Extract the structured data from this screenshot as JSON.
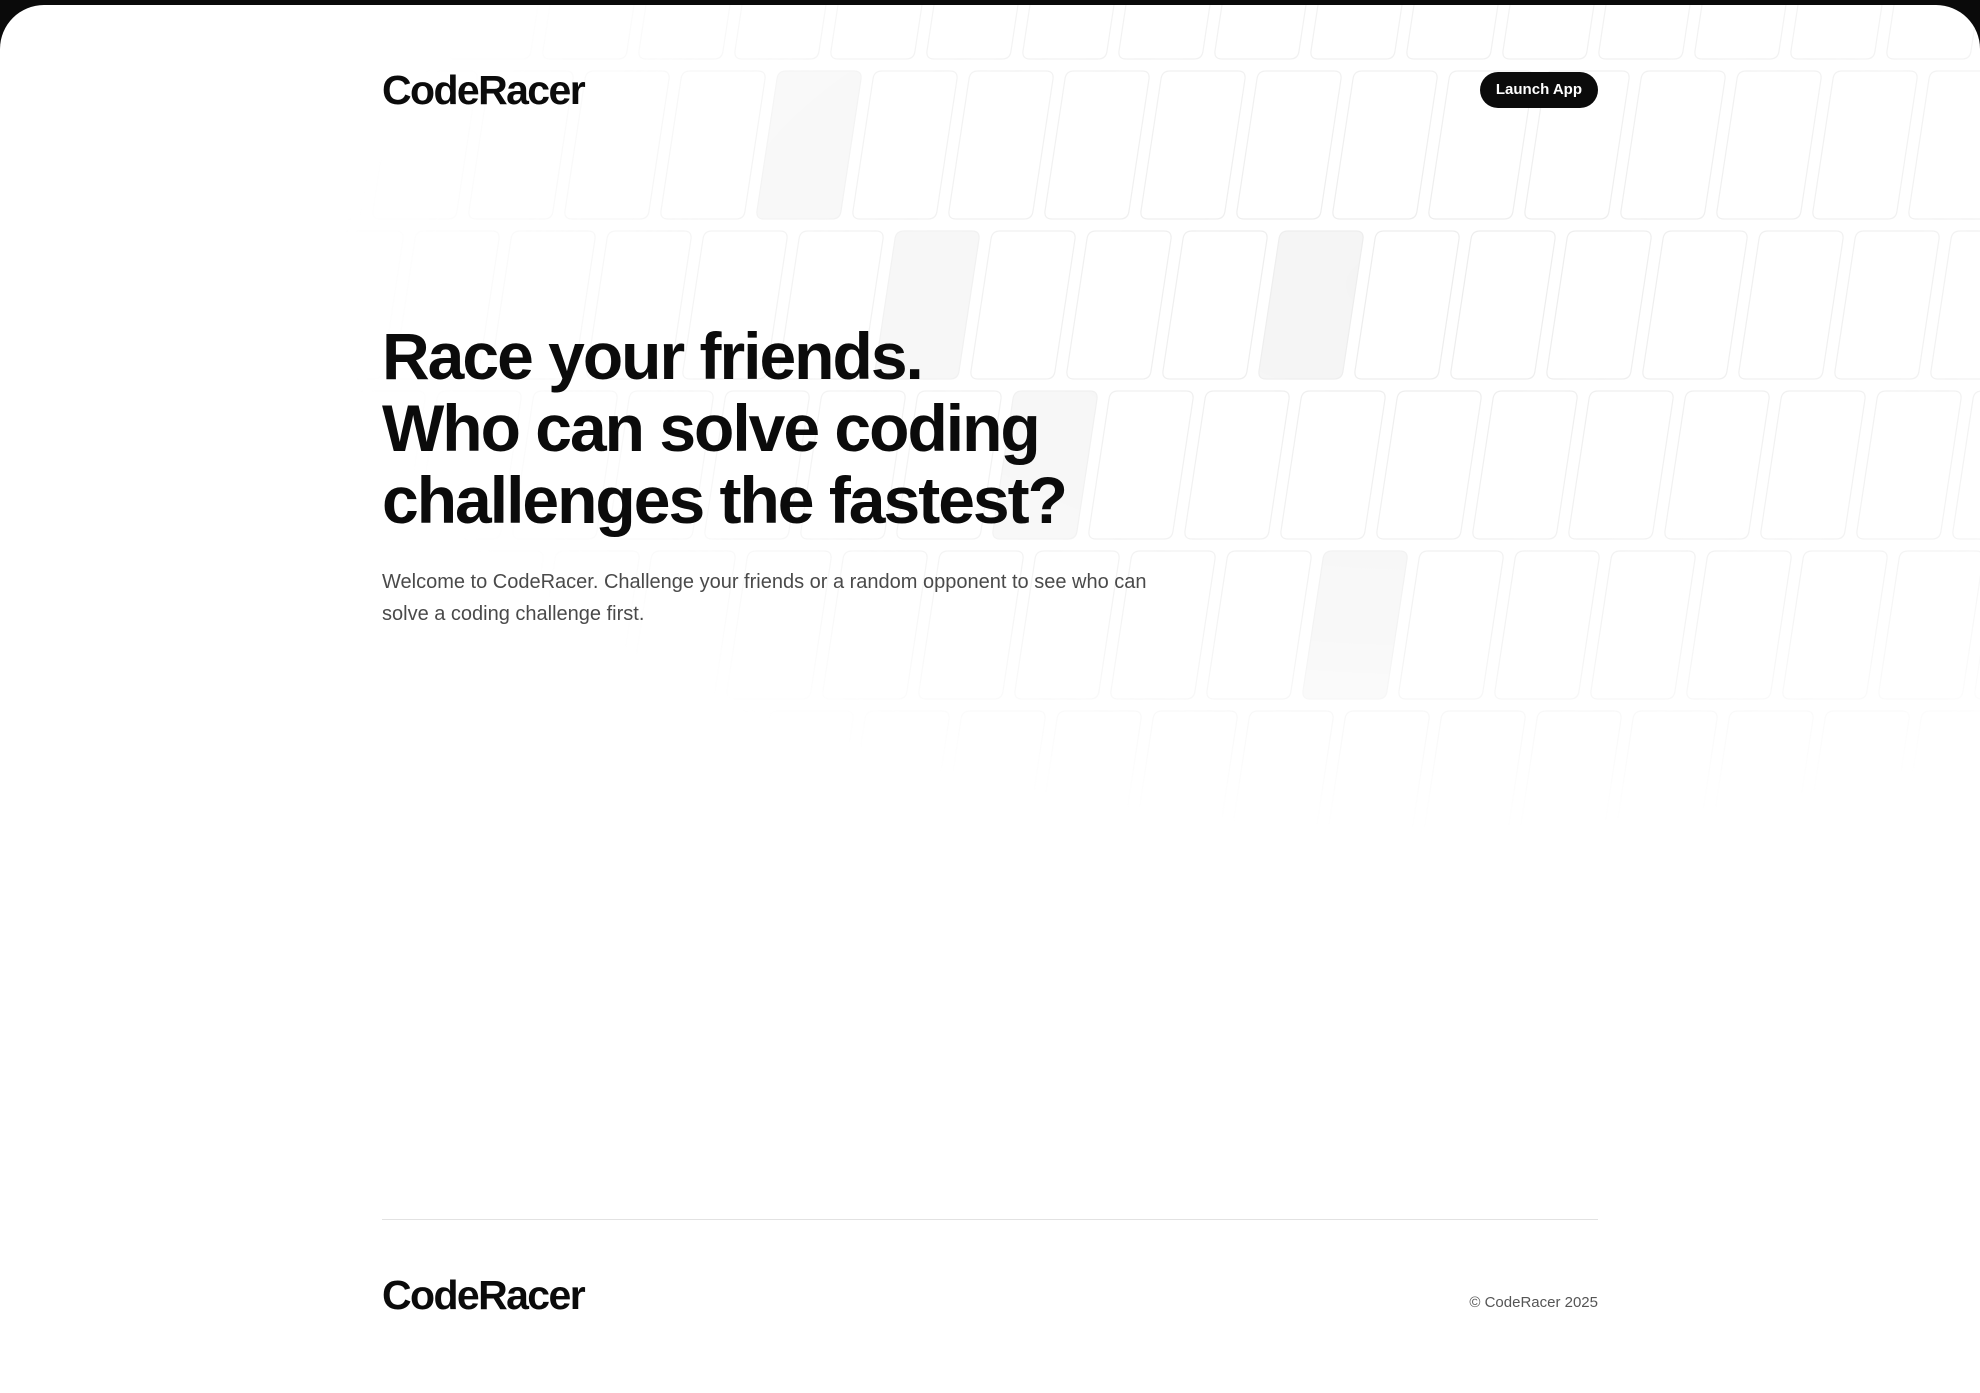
{
  "header": {
    "logo": "CodeRacer",
    "launch_button": "Launch App"
  },
  "hero": {
    "title_lines": [
      "Race your friends.",
      "Who can solve coding",
      "challenges the fastest?"
    ],
    "subtitle": "Welcome to CodeRacer. Challenge your friends or a random opponent to see who can solve a coding challenge first."
  },
  "footer": {
    "logo": "CodeRacer",
    "copyright": "© CodeRacer 2025"
  },
  "colors": {
    "background": "#ffffff",
    "text": "#0b0b0b",
    "button": "#0b0b0b",
    "subtle_text": "#4a4a4a"
  }
}
